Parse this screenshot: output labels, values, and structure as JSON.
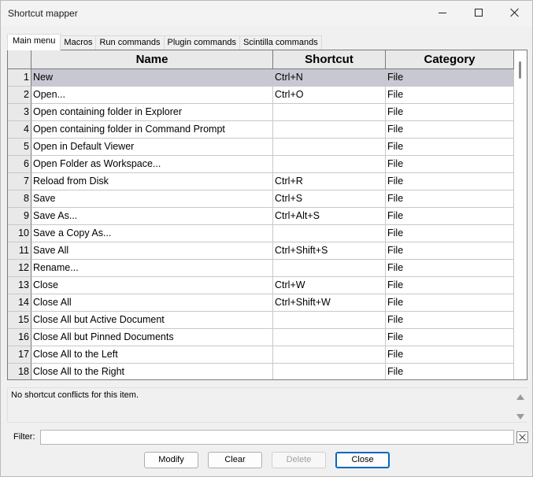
{
  "window": {
    "title": "Shortcut mapper"
  },
  "tabs": [
    {
      "label": "Main menu",
      "active": true
    },
    {
      "label": "Macros",
      "active": false
    },
    {
      "label": "Run commands",
      "active": false
    },
    {
      "label": "Plugin commands",
      "active": false
    },
    {
      "label": "Scintilla commands",
      "active": false
    }
  ],
  "grid": {
    "columns": {
      "name": "Name",
      "shortcut": "Shortcut",
      "category": "Category"
    },
    "selected_row": 1,
    "rows": [
      {
        "num": "1",
        "name": "New",
        "shortcut": "Ctrl+N",
        "category": "File"
      },
      {
        "num": "2",
        "name": "Open...",
        "shortcut": "Ctrl+O",
        "category": "File"
      },
      {
        "num": "3",
        "name": "Open containing folder in Explorer",
        "shortcut": "",
        "category": "File"
      },
      {
        "num": "4",
        "name": "Open containing folder in Command Prompt",
        "shortcut": "",
        "category": "File"
      },
      {
        "num": "5",
        "name": "Open in Default Viewer",
        "shortcut": "",
        "category": "File"
      },
      {
        "num": "6",
        "name": "Open Folder as Workspace...",
        "shortcut": "",
        "category": "File"
      },
      {
        "num": "7",
        "name": "Reload from Disk",
        "shortcut": "Ctrl+R",
        "category": "File"
      },
      {
        "num": "8",
        "name": "Save",
        "shortcut": "Ctrl+S",
        "category": "File"
      },
      {
        "num": "9",
        "name": "Save As...",
        "shortcut": "Ctrl+Alt+S",
        "category": "File"
      },
      {
        "num": "10",
        "name": "Save a Copy As...",
        "shortcut": "",
        "category": "File"
      },
      {
        "num": "11",
        "name": "Save All",
        "shortcut": "Ctrl+Shift+S",
        "category": "File"
      },
      {
        "num": "12",
        "name": "Rename...",
        "shortcut": "",
        "category": "File"
      },
      {
        "num": "13",
        "name": "Close",
        "shortcut": "Ctrl+W",
        "category": "File"
      },
      {
        "num": "14",
        "name": "Close All",
        "shortcut": "Ctrl+Shift+W",
        "category": "File"
      },
      {
        "num": "15",
        "name": "Close All but Active Document",
        "shortcut": "",
        "category": "File"
      },
      {
        "num": "16",
        "name": "Close All but Pinned Documents",
        "shortcut": "",
        "category": "File"
      },
      {
        "num": "17",
        "name": "Close All to the Left",
        "shortcut": "",
        "category": "File"
      },
      {
        "num": "18",
        "name": "Close All to the Right",
        "shortcut": "",
        "category": "File"
      }
    ]
  },
  "info": {
    "text": "No shortcut conflicts for this item."
  },
  "filter": {
    "label": "Filter:",
    "value": "",
    "placeholder": ""
  },
  "buttons": {
    "modify": "Modify",
    "clear": "Clear",
    "delete": "Delete",
    "close": "Close"
  },
  "icons": {
    "minimize": "minimize-icon",
    "maximize": "maximize-icon",
    "close": "close-icon",
    "filter_clear": "clear-x-icon",
    "scroll_up": "arrow-up-icon",
    "scroll_down": "arrow-down-icon"
  }
}
